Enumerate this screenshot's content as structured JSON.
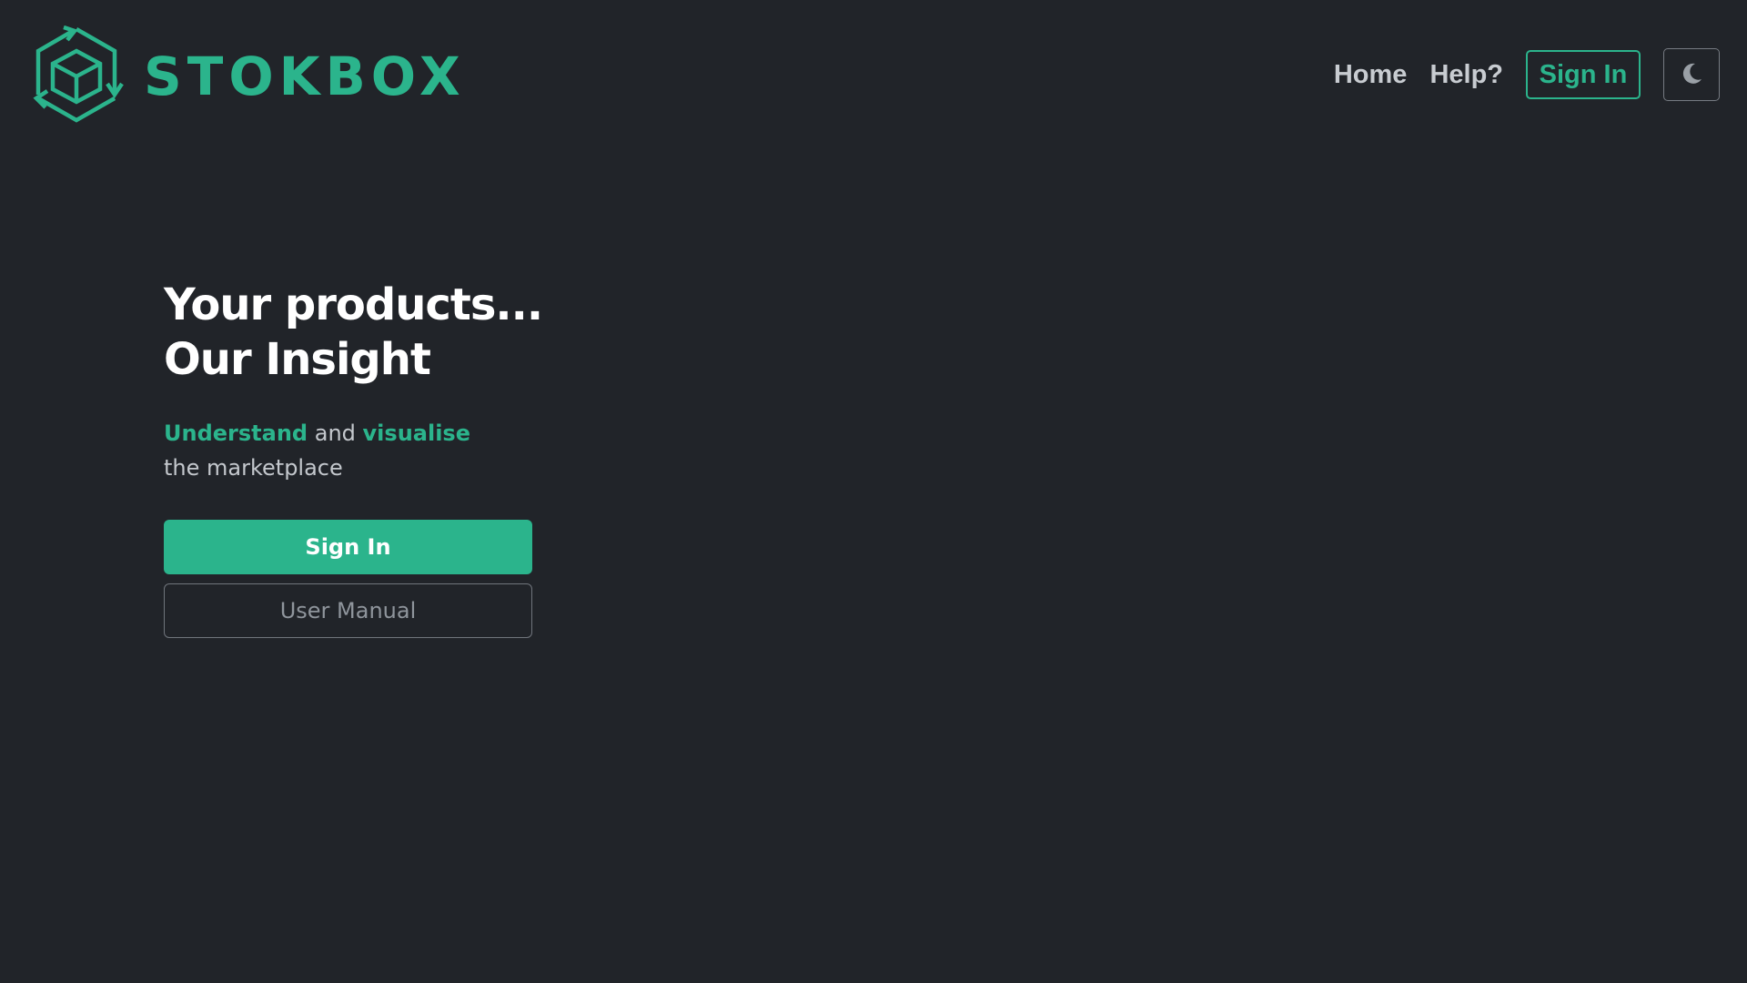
{
  "brand": {
    "name": "STOKBOX",
    "logo_icon": "box-recycle-logo-icon",
    "accent_color": "#2bb48c",
    "background_color": "#212429"
  },
  "nav": {
    "home_label": "Home",
    "help_label": "Help?",
    "signin_label": "Sign In",
    "theme_icon": "moon-icon"
  },
  "hero": {
    "title_line1": "Your products...",
    "title_line2": "Our Insight",
    "subtitle_word1": "Understand",
    "subtitle_and": "and",
    "subtitle_word2": "visualise",
    "subtitle_rest": "the marketplace",
    "signin_button": "Sign In",
    "manual_button": "User Manual"
  }
}
